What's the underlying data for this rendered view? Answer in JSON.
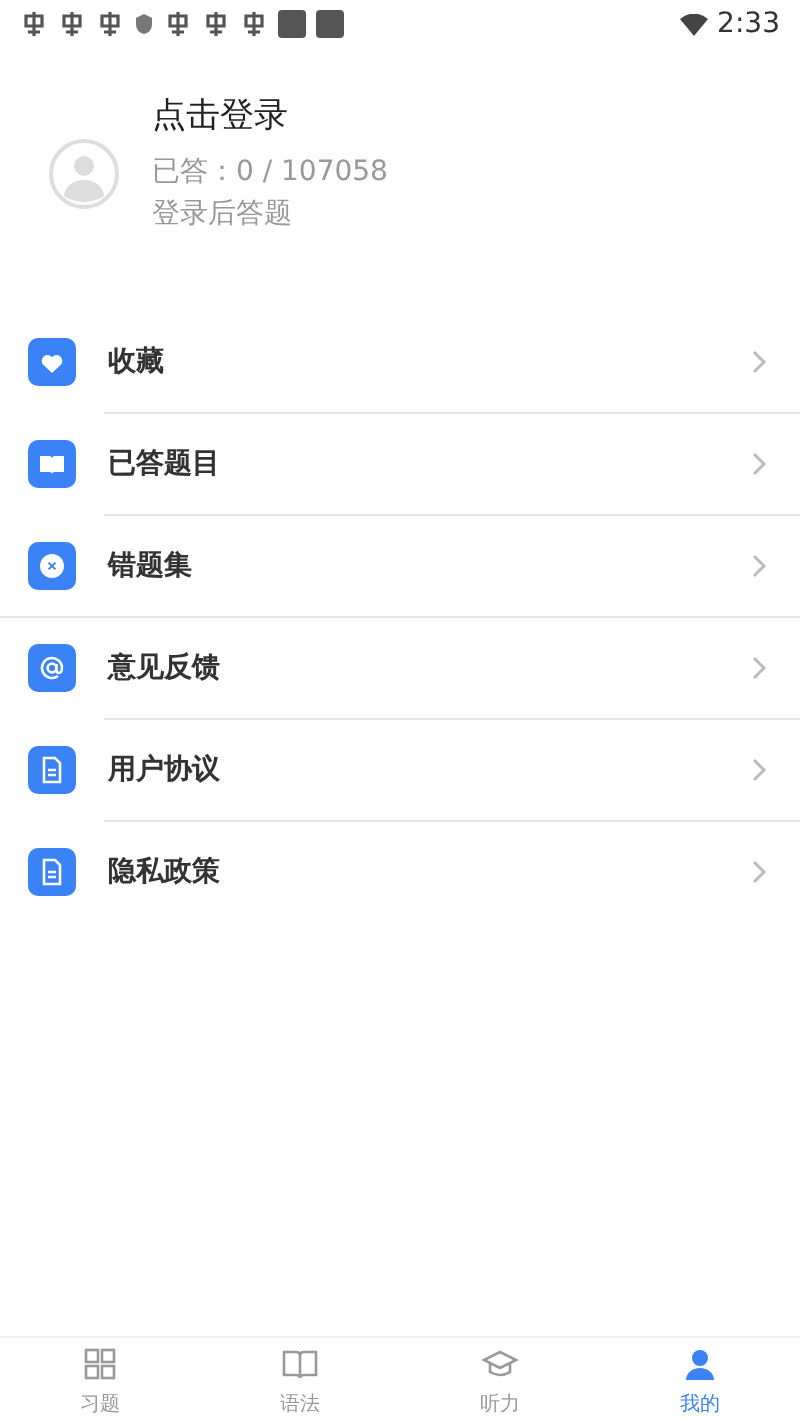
{
  "status_bar": {
    "time": "2:33"
  },
  "profile": {
    "title": "点击登录",
    "answered": "已答：0 / 107058",
    "hint": "登录后答题"
  },
  "menu_groups": [
    [
      {
        "label": "收藏",
        "kind": "heart"
      },
      {
        "label": "已答题目",
        "kind": "book"
      },
      {
        "label": "错题集",
        "kind": "cross"
      }
    ],
    [
      {
        "label": "意见反馈",
        "kind": "at"
      },
      {
        "label": "用户协议",
        "kind": "doc"
      },
      {
        "label": "隐私政策",
        "kind": "doc"
      }
    ]
  ],
  "tabs": [
    {
      "label": "习题",
      "selected": false
    },
    {
      "label": "语法",
      "selected": false
    },
    {
      "label": "听力",
      "selected": false
    },
    {
      "label": "我的",
      "selected": true
    }
  ]
}
